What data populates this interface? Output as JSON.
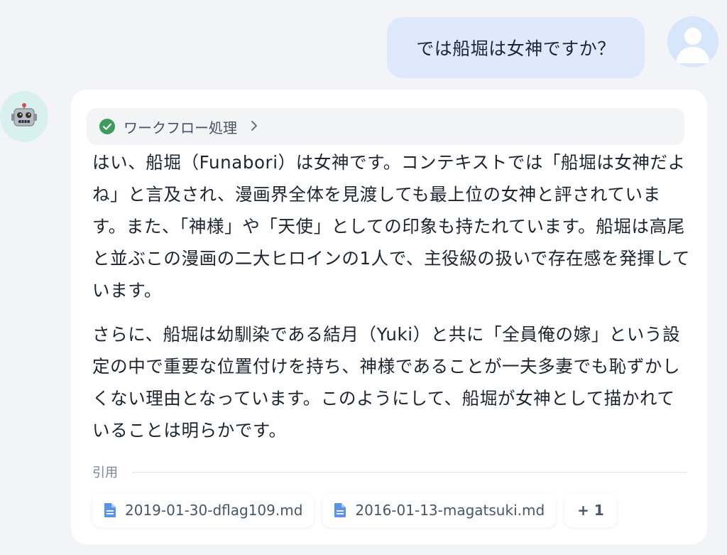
{
  "user": {
    "message": "では船堀は女神ですか？",
    "avatar_icon": "user-icon"
  },
  "bot": {
    "avatar_icon": "robot-icon",
    "workflow": {
      "label": "ワークフロー処理",
      "status_icon": "check-circle-icon",
      "expand_icon": "chevron-right-icon"
    },
    "paragraphs": [
      "はい、船堀（Funabori）は女神です。コンテキストでは「船堀は女神だよね」と言及され、漫画界全体を見渡しても最上位の女神と評されています。また、「神様」や「天使」としての印象も持たれています。船堀は高尾と並ぶこの漫画の二大ヒロインの1人で、主役級の扱いで存在感を発揮しています。",
      "さらに、船堀は幼馴染である結月（Yuki）と共に「全員俺の嫁」という設定の中で重要な位置付けを持ち、神様であることが一夫多妻でも恥ずかしくない理由となっています。このようにして、船堀が女神として描かれていることは明らかです。"
    ],
    "citations": {
      "label": "引用",
      "files": [
        {
          "name": "2019-01-30-dflag109.md",
          "icon": "document-icon"
        },
        {
          "name": "2016-01-13-magatsuki.md",
          "icon": "document-icon"
        }
      ],
      "more": "+ 1"
    }
  },
  "colors": {
    "user_bubble": "#dfe9fd",
    "success": "#3f9a5e",
    "doc_icon": "#5b93e8"
  }
}
